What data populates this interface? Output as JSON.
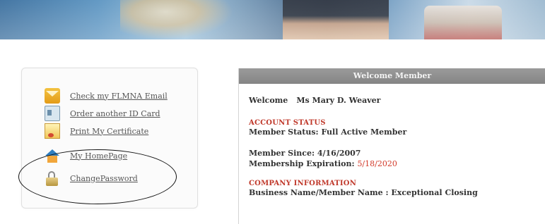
{
  "menu": {
    "items": [
      {
        "label": "Check my FLMNA Email",
        "icon": "mail-icon"
      },
      {
        "label": "Order another ID Card",
        "icon": "id-card-icon"
      },
      {
        "label": "Print My Certificate",
        "icon": "certificate-icon"
      },
      {
        "label": "My HomePage",
        "icon": "home-icon"
      },
      {
        "label": "ChangePassword",
        "icon": "lock-icon"
      }
    ]
  },
  "panel": {
    "header": "Welcome Member",
    "welcome_label": "Welcome",
    "member_name": "Ms Mary D. Weaver",
    "account_status_title": "ACCOUNT STATUS",
    "member_status": "Member Status: Full Active Member",
    "member_since": "Member Since: 4/16/2007",
    "membership_expiration_label": "Membership Expiration:",
    "membership_expiration_value": "5/18/2020",
    "company_info_title": "COMPANY INFORMATION",
    "business_name": "Business Name/Member Name : Exceptional Closing"
  },
  "colors": {
    "header_bg": "#8f8f8f",
    "section_title": "#c0392b",
    "expiration": "#d23a2a",
    "link": "#555555"
  }
}
